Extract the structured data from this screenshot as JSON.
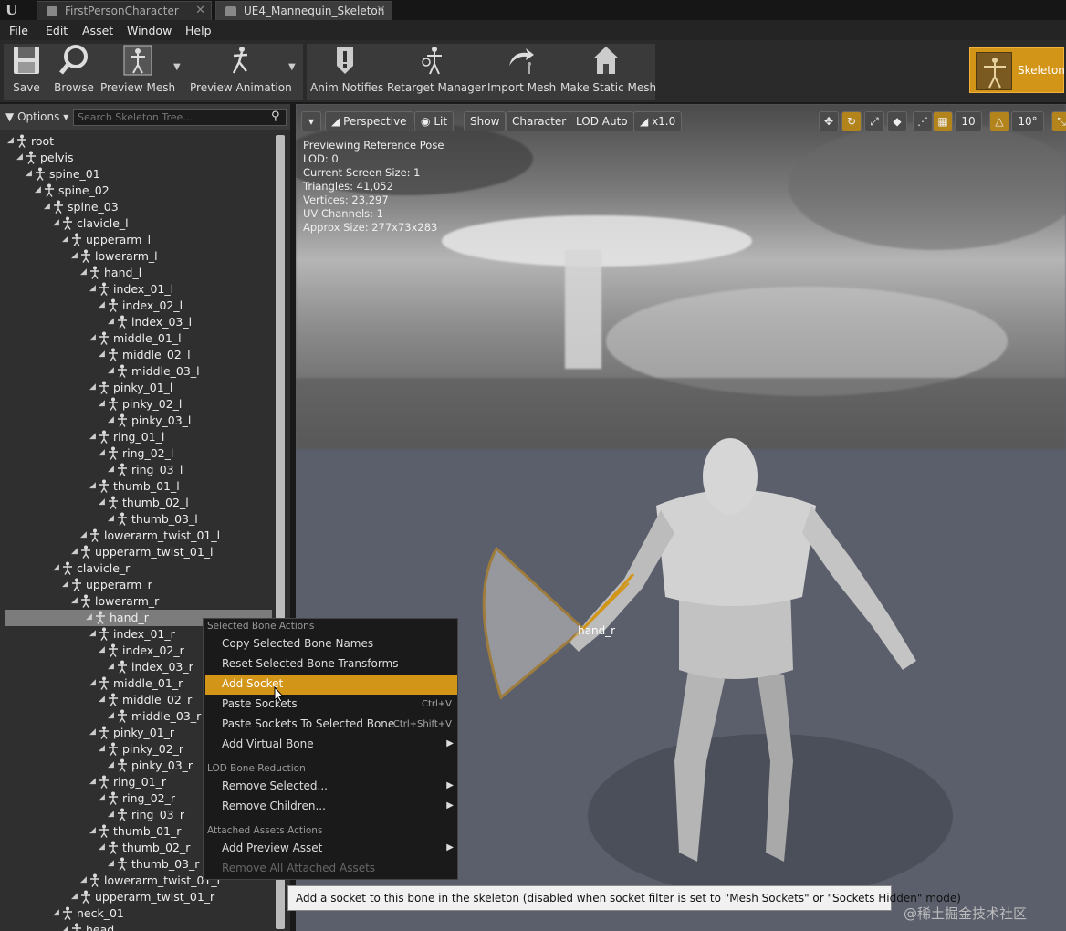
{
  "tabs": [
    {
      "label": "FirstPersonCharacter",
      "close": "✕"
    },
    {
      "label": "UE4_Mannequin_Skeleton",
      "close": "✕"
    }
  ],
  "logo_icon": "unreal-engine-logo",
  "menu": [
    "File",
    "Edit",
    "Asset",
    "Window",
    "Help"
  ],
  "toolbar": {
    "save": "Save",
    "browse": "Browse",
    "preview_mesh": "Preview Mesh",
    "preview_animation": "Preview Animation",
    "anim_notifies": "Anim Notifies",
    "retarget_manager": "Retarget Manager",
    "import_mesh": "Import Mesh",
    "make_static_mesh": "Make Static Mesh",
    "skeleton": "Skeleton"
  },
  "left_panel": {
    "options_label": "Options",
    "search_placeholder": "Search Skeleton Tree...",
    "bones": [
      {
        "name": "root",
        "depth": 0
      },
      {
        "name": "pelvis",
        "depth": 1
      },
      {
        "name": "spine_01",
        "depth": 2
      },
      {
        "name": "spine_02",
        "depth": 3
      },
      {
        "name": "spine_03",
        "depth": 4
      },
      {
        "name": "clavicle_l",
        "depth": 5
      },
      {
        "name": "upperarm_l",
        "depth": 6
      },
      {
        "name": "lowerarm_l",
        "depth": 7
      },
      {
        "name": "hand_l",
        "depth": 8
      },
      {
        "name": "index_01_l",
        "depth": 9
      },
      {
        "name": "index_02_l",
        "depth": 10
      },
      {
        "name": "index_03_l",
        "depth": 11
      },
      {
        "name": "middle_01_l",
        "depth": 9
      },
      {
        "name": "middle_02_l",
        "depth": 10
      },
      {
        "name": "middle_03_l",
        "depth": 11
      },
      {
        "name": "pinky_01_l",
        "depth": 9
      },
      {
        "name": "pinky_02_l",
        "depth": 10
      },
      {
        "name": "pinky_03_l",
        "depth": 11
      },
      {
        "name": "ring_01_l",
        "depth": 9
      },
      {
        "name": "ring_02_l",
        "depth": 10
      },
      {
        "name": "ring_03_l",
        "depth": 11
      },
      {
        "name": "thumb_01_l",
        "depth": 9
      },
      {
        "name": "thumb_02_l",
        "depth": 10
      },
      {
        "name": "thumb_03_l",
        "depth": 11
      },
      {
        "name": "lowerarm_twist_01_l",
        "depth": 8
      },
      {
        "name": "upperarm_twist_01_l",
        "depth": 7
      },
      {
        "name": "clavicle_r",
        "depth": 5
      },
      {
        "name": "upperarm_r",
        "depth": 6
      },
      {
        "name": "lowerarm_r",
        "depth": 7
      },
      {
        "name": "hand_r",
        "depth": 8,
        "selected": true
      },
      {
        "name": "index_01_r",
        "depth": 9
      },
      {
        "name": "index_02_r",
        "depth": 10
      },
      {
        "name": "index_03_r",
        "depth": 11
      },
      {
        "name": "middle_01_r",
        "depth": 9
      },
      {
        "name": "middle_02_r",
        "depth": 10
      },
      {
        "name": "middle_03_r",
        "depth": 11
      },
      {
        "name": "pinky_01_r",
        "depth": 9
      },
      {
        "name": "pinky_02_r",
        "depth": 10
      },
      {
        "name": "pinky_03_r",
        "depth": 11
      },
      {
        "name": "ring_01_r",
        "depth": 9
      },
      {
        "name": "ring_02_r",
        "depth": 10
      },
      {
        "name": "ring_03_r",
        "depth": 11
      },
      {
        "name": "thumb_01_r",
        "depth": 9
      },
      {
        "name": "thumb_02_r",
        "depth": 10
      },
      {
        "name": "thumb_03_r",
        "depth": 11
      },
      {
        "name": "lowerarm_twist_01_r",
        "depth": 8
      },
      {
        "name": "upperarm_twist_01_r",
        "depth": 7
      },
      {
        "name": "neck_01",
        "depth": 5
      },
      {
        "name": "head",
        "depth": 6
      }
    ]
  },
  "viewport": {
    "perspective": "Perspective",
    "lit": "Lit",
    "show": "Show",
    "character": "Character",
    "lod": "LOD Auto",
    "speed": "x1.0",
    "grid_size": "10",
    "rot_snap": "10°",
    "stats": [
      "Previewing Reference Pose",
      "LOD: 0",
      "Current Screen Size: 1",
      "Triangles: 41,052",
      "Vertices: 23,297",
      "UV Channels: 1",
      "Approx Size: 277x73x283"
    ],
    "bone_label": "hand_r"
  },
  "context_menu": {
    "section1": "Selected Bone Actions",
    "copy_names": "Copy Selected Bone Names",
    "reset_transforms": "Reset Selected Bone Transforms",
    "add_socket": "Add Socket",
    "paste_sockets": "Paste Sockets",
    "paste_sockets_shortcut": "Ctrl+V",
    "paste_to_bone": "Paste Sockets To Selected Bone",
    "paste_to_bone_shortcut": "Ctrl+Shift+V",
    "add_virtual_bone": "Add Virtual Bone",
    "section2": "LOD Bone Reduction",
    "remove_selected": "Remove Selected...",
    "remove_children": "Remove Children...",
    "section3": "Attached Assets Actions",
    "add_preview_asset": "Add Preview Asset",
    "remove_all_attached": "Remove All Attached Assets"
  },
  "tooltip": "Add a socket to this bone in the skeleton (disabled when socket filter is set to \"Mesh Sockets\" or \"Sockets Hidden\" mode)",
  "watermark": "@稀土掘金技术社区",
  "colors": {
    "accent": "#d39517",
    "selection": "#7c7c7c",
    "viewport_bg": "#5b5f6c"
  }
}
